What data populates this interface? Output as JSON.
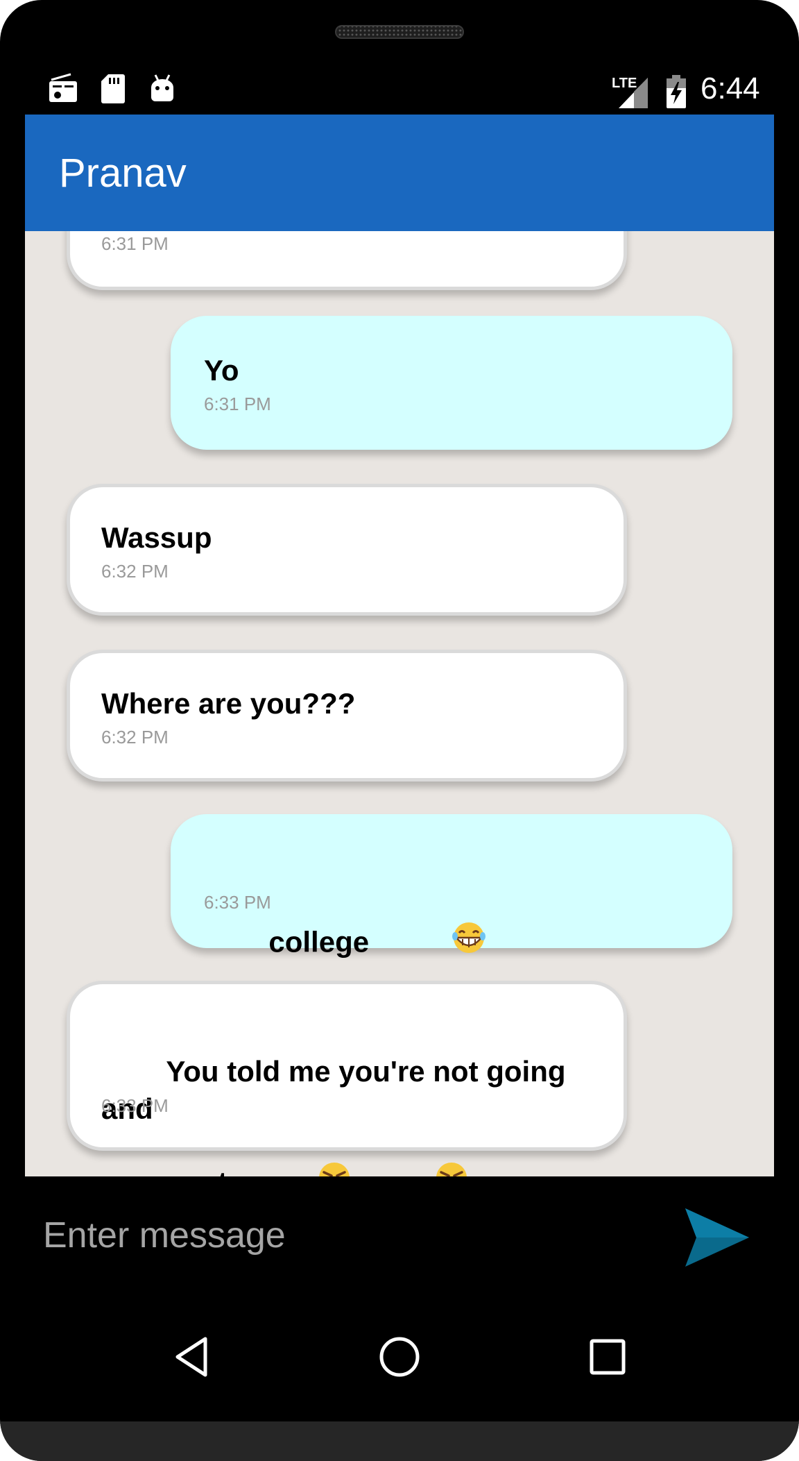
{
  "status_bar": {
    "time": "6:44",
    "network": "LTE",
    "icons": [
      "radio-icon",
      "sd-card-icon",
      "android-debug-icon",
      "lte-signal-icon",
      "battery-charging-icon"
    ]
  },
  "app_bar": {
    "title": "Pranav",
    "color": "#1a68bf"
  },
  "messages": [
    {
      "direction": "incoming",
      "text": "",
      "time": "6:31 PM"
    },
    {
      "direction": "outgoing",
      "text": "Yo",
      "time": "6:31 PM"
    },
    {
      "direction": "incoming",
      "text": "Wassup",
      "time": "6:32 PM"
    },
    {
      "direction": "incoming",
      "text": "Where are you???",
      "time": "6:32 PM"
    },
    {
      "direction": "outgoing",
      "text": "college",
      "emoji": [
        "laughing-face"
      ],
      "time": "6:33 PM"
    },
    {
      "direction": "incoming",
      "text": "You told me you're not going and\nyou went ",
      "emoji": [
        "angry-face",
        "angry-face"
      ],
      "time": "6:33 PM"
    }
  ],
  "composer": {
    "placeholder": "Enter message",
    "send_icon": "send-icon"
  },
  "colors": {
    "incoming_bubble": "#ffffff",
    "outgoing_bubble": "#d4ffff",
    "chat_background": "#e9e5e1",
    "send_icon": "#0a6a8c"
  },
  "nav_bar": {
    "buttons": [
      "back-icon",
      "home-icon",
      "recents-icon"
    ]
  }
}
